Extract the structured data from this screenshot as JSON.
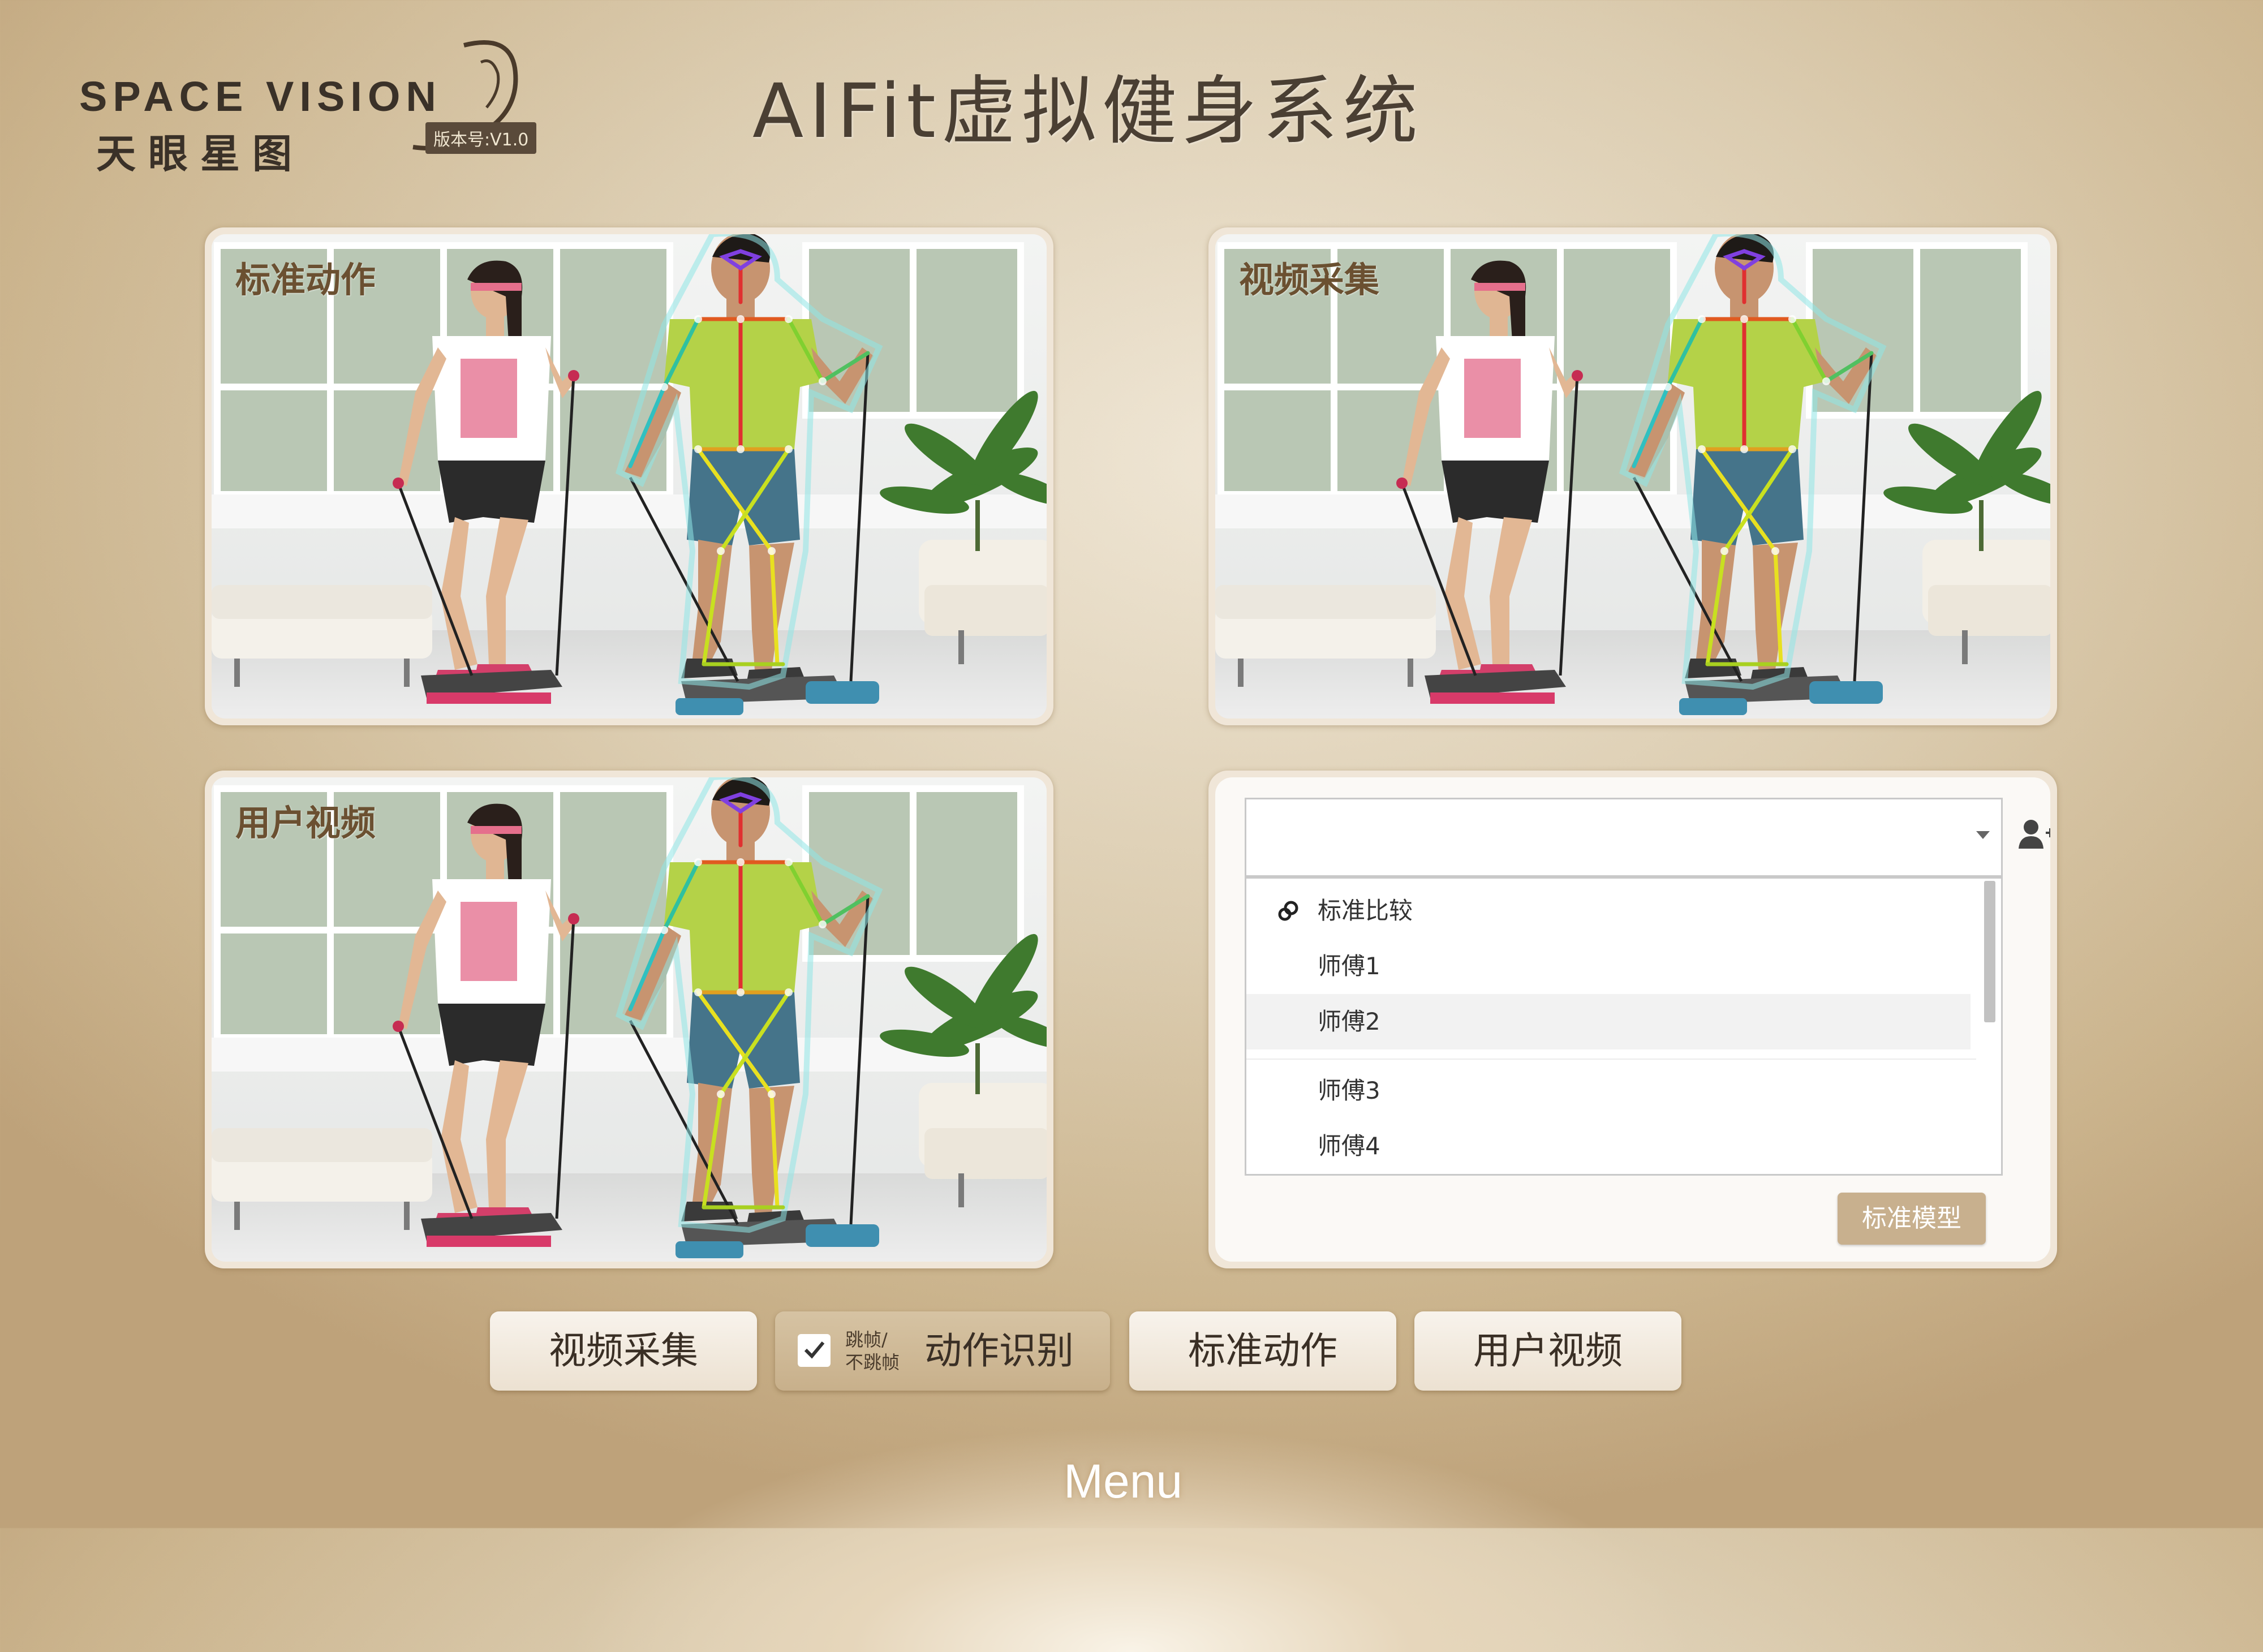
{
  "header": {
    "logo_en": "SPACE VISION",
    "logo_cn": "天眼星图",
    "version": "版本号:V1.0",
    "title": "AIFit虚拟健身系统"
  },
  "panels": {
    "top_left": {
      "label": "标准动作"
    },
    "top_right": {
      "label": "视频采集"
    },
    "bottom_left": {
      "label": "用户视频"
    }
  },
  "selector": {
    "combo_value": "",
    "group_label": "标准比较",
    "items": [
      "师傅1",
      "师傅2",
      "师傅3",
      "师傅4"
    ],
    "hovered_item": "师傅2",
    "model_button": "标准模型"
  },
  "buttons": {
    "video_capture": "视频采集",
    "skip_frame_line1": "跳帧/",
    "skip_frame_line2": "不跳帧",
    "skip_frame_checked": true,
    "action_recognition": "动作识别",
    "standard_action": "标准动作",
    "user_video": "用户视频"
  },
  "menu": {
    "label": "Menu"
  },
  "colors": {
    "accent": "#c8b08e",
    "title_text": "#4a3f33",
    "panel_label": "#6b5031"
  },
  "icons": {
    "group": "link-icon",
    "add_user": "add-user-icon",
    "dropdown": "chevron-down-icon",
    "check": "check-icon"
  }
}
